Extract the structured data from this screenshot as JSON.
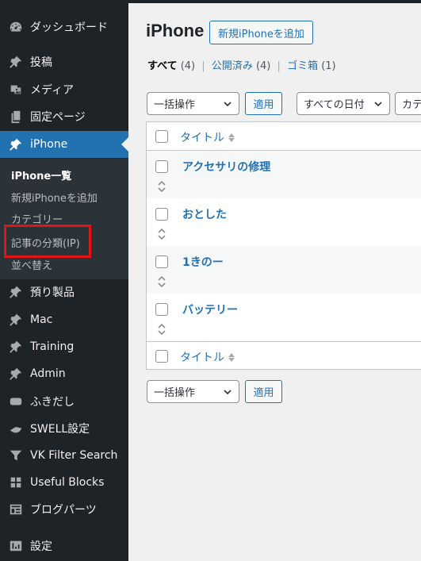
{
  "sidebar": {
    "items": [
      {
        "label": "ダッシュボード",
        "icon": "dashboard-icon"
      },
      {
        "label": "投稿",
        "icon": "pin-icon"
      },
      {
        "label": "メディア",
        "icon": "media-icon"
      },
      {
        "label": "固定ページ",
        "icon": "pages-icon"
      },
      {
        "label": "iPhone",
        "icon": "pin-icon"
      },
      {
        "label": "預り製品",
        "icon": "pin-icon"
      },
      {
        "label": "Mac",
        "icon": "pin-icon"
      },
      {
        "label": "Training",
        "icon": "pin-icon"
      },
      {
        "label": "Admin",
        "icon": "pin-icon"
      },
      {
        "label": "ふきだし",
        "icon": "speech-bubble-icon"
      },
      {
        "label": "SWELL設定",
        "icon": "swell-icon"
      },
      {
        "label": "VK Filter Search",
        "icon": "filter-icon"
      },
      {
        "label": "Useful Blocks",
        "icon": "blocks-grid-icon"
      },
      {
        "label": "ブログパーツ",
        "icon": "blog-parts-icon"
      },
      {
        "label": "設定",
        "icon": "settings-icon"
      }
    ],
    "submenu": [
      {
        "label": "iPhone一覧"
      },
      {
        "label": "新規iPhoneを追加"
      },
      {
        "label": "カテゴリー"
      },
      {
        "label": "記事の分類(IP)"
      },
      {
        "label": "並べ替え"
      }
    ],
    "highlight_color": "#e3131a"
  },
  "header": {
    "title": "iPhone",
    "add_button": "新規iPhoneを追加"
  },
  "filters": {
    "all_label": "すべて",
    "all_count": "(4)",
    "published_label": "公開済み",
    "published_count": "(4)",
    "trash_label": "ゴミ箱",
    "trash_count": "(1)",
    "separator": "|"
  },
  "toolbar": {
    "bulk_action": "一括操作",
    "apply": "適用",
    "all_dates": "すべての日付",
    "category": "カテ"
  },
  "table": {
    "column_title": "タイトル",
    "rows": [
      {
        "title": "アクセサリの修理"
      },
      {
        "title": "おとした"
      },
      {
        "title": "1きのー"
      },
      {
        "title": "バッテリー"
      }
    ]
  },
  "bottom_toolbar": {
    "bulk_action": "一括操作",
    "apply": "適用"
  },
  "colors": {
    "sidebar_bg": "#1d2327",
    "submenu_bg": "#2c3338",
    "accent": "#2271b1"
  }
}
